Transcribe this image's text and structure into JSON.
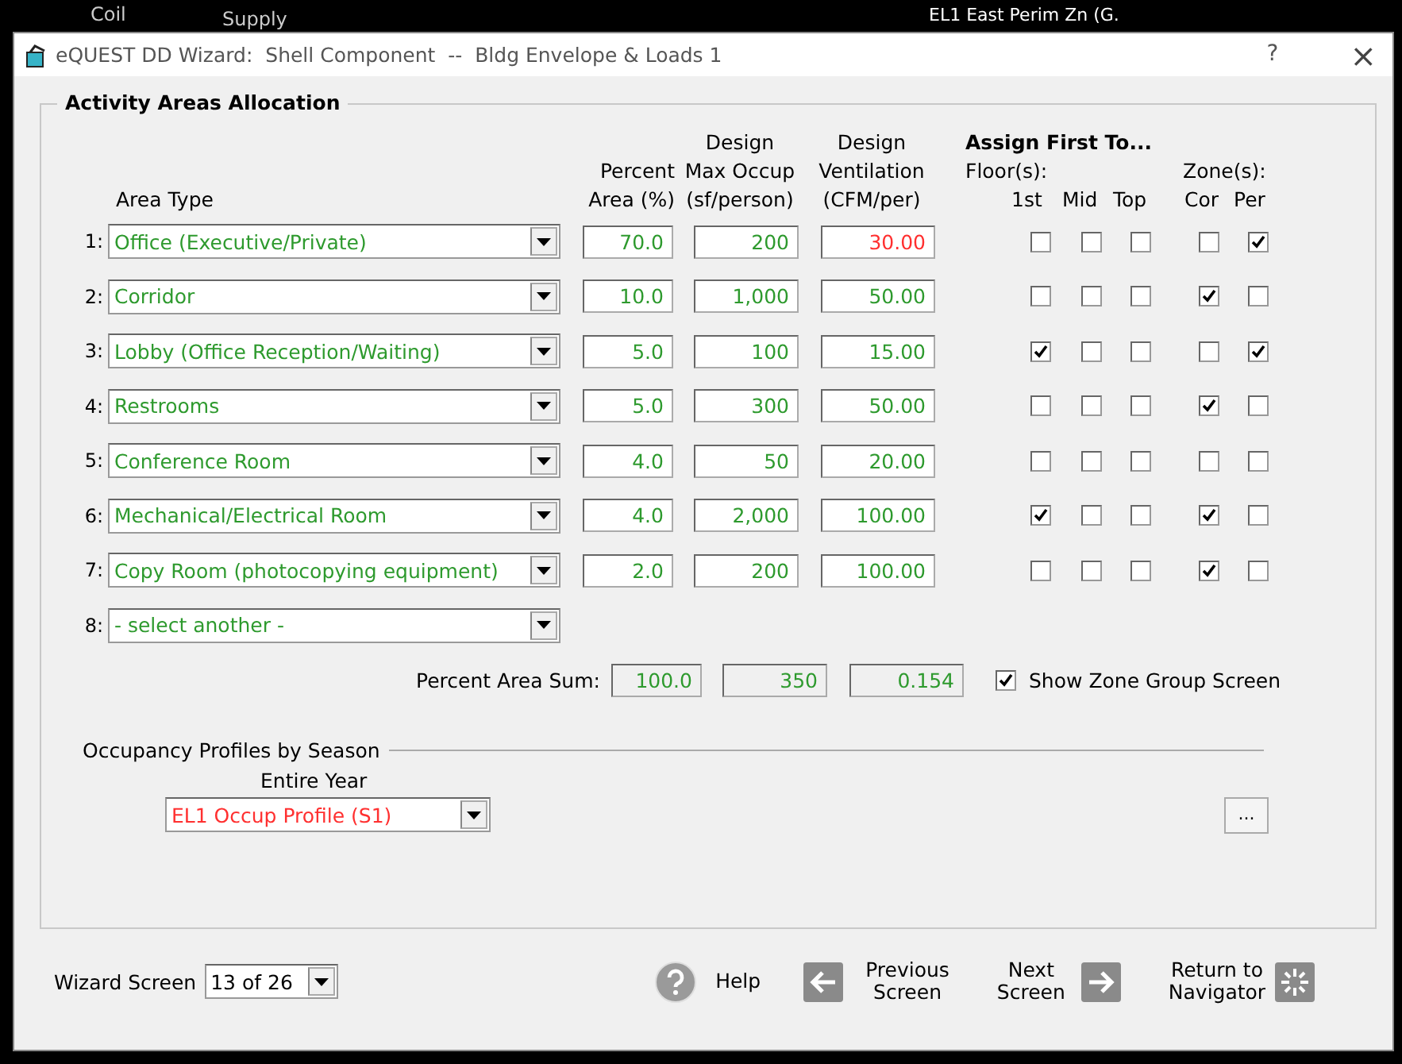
{
  "background": {
    "texts": [
      "Coil",
      "Supply",
      "EL1 East Perim Zn (G."
    ]
  },
  "window": {
    "title": "eQUEST DD Wizard:  Shell Component  --  Bldg Envelope & Loads 1",
    "help": "?",
    "close": "×"
  },
  "activity_areas": {
    "title": "Activity Areas Allocation",
    "headers": {
      "area_type": "Area Type",
      "percent": [
        "Percent",
        "Area (%)"
      ],
      "max_occup": [
        "Design",
        "Max Occup",
        "(sf/person)"
      ],
      "ventilation": [
        "Design",
        "Ventilation",
        "(CFM/per)"
      ],
      "assign": "Assign First To...",
      "floors": "Floor(s):",
      "zones": "Zone(s):",
      "floor_cols": [
        "1st",
        "Mid",
        "Top"
      ],
      "zone_cols": [
        "Cor",
        "Per"
      ]
    },
    "rows": [
      {
        "kind": "area",
        "number": "1:",
        "area_type": "Office (Executive/Private)",
        "percent_area": "70.0",
        "max_occup": "200",
        "ventilation": "30.00",
        "ventilation_highlighted": true,
        "floors": [
          false,
          false,
          false
        ],
        "zones": [
          false,
          true
        ]
      },
      {
        "kind": "area",
        "number": "2:",
        "area_type": "Corridor",
        "percent_area": "10.0",
        "max_occup": "1,000",
        "ventilation": "50.00",
        "ventilation_highlighted": false,
        "floors": [
          false,
          false,
          false
        ],
        "zones": [
          true,
          false
        ]
      },
      {
        "kind": "area",
        "number": "3:",
        "area_type": "Lobby (Office Reception/Waiting)",
        "percent_area": "5.0",
        "max_occup": "100",
        "ventilation": "15.00",
        "ventilation_highlighted": false,
        "floors": [
          true,
          false,
          false
        ],
        "zones": [
          false,
          true
        ]
      },
      {
        "kind": "area",
        "number": "4:",
        "area_type": "Restrooms",
        "percent_area": "5.0",
        "max_occup": "300",
        "ventilation": "50.00",
        "ventilation_highlighted": false,
        "floors": [
          false,
          false,
          false
        ],
        "zones": [
          true,
          false
        ]
      },
      {
        "kind": "area",
        "number": "5:",
        "area_type": "Conference Room",
        "percent_area": "4.0",
        "max_occup": "50",
        "ventilation": "20.00",
        "ventilation_highlighted": false,
        "floors": [
          false,
          false,
          false
        ],
        "zones": [
          false,
          false
        ]
      },
      {
        "kind": "area",
        "number": "6:",
        "area_type": "Mechanical/Electrical Room",
        "percent_area": "4.0",
        "max_occup": "2,000",
        "ventilation": "100.00",
        "ventilation_highlighted": false,
        "floors": [
          true,
          false,
          false
        ],
        "zones": [
          true,
          false
        ]
      },
      {
        "kind": "area",
        "number": "7:",
        "area_type": "Copy Room (photocopying equipment)",
        "percent_area": "2.0",
        "max_occup": "200",
        "ventilation": "100.00",
        "ventilation_highlighted": false,
        "floors": [
          false,
          false,
          false
        ],
        "zones": [
          true,
          false
        ]
      },
      {
        "kind": "empty",
        "number": "8:",
        "area_type": "- select another -"
      }
    ],
    "sum": {
      "label": "Percent Area Sum:",
      "percent_area": "100.0",
      "max_occup": "350",
      "ventilation": "0.154"
    },
    "show_zone_group": {
      "label": "Show Zone Group Screen",
      "checked": true
    }
  },
  "occupancy": {
    "title": "Occupancy Profiles by Season",
    "season": "Entire Year",
    "profile": "EL1 Occup Profile (S1)",
    "highlighted": true,
    "more_button": "..."
  },
  "footer": {
    "wizard_label": "Wizard Screen",
    "wizard_screen": "13 of 26",
    "help": "Help",
    "previous": [
      "Previous",
      "Screen"
    ],
    "next": [
      "Next",
      "Screen"
    ],
    "return": [
      "Return to",
      "Navigator"
    ]
  }
}
